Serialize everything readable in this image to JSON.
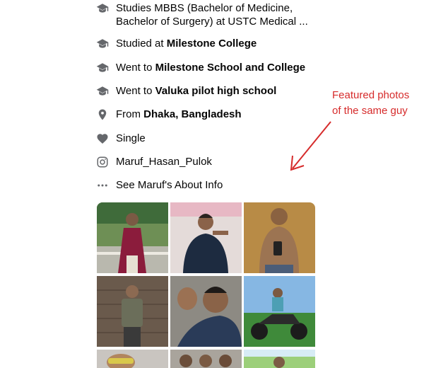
{
  "intro": {
    "studies": {
      "text": "Studies MBBS (Bachelor of Medicine, Bachelor of Surgery) at USTC Medical ...",
      "icon": "graduation-cap-icon"
    },
    "studied": {
      "prefix": "Studied at ",
      "place": "Milestone College",
      "icon": "graduation-cap-icon"
    },
    "went_to_1": {
      "prefix": "Went to ",
      "place": "Milestone School and College",
      "icon": "graduation-cap-icon"
    },
    "went_to_2": {
      "prefix": "Went to ",
      "place": "Valuka pilot high school",
      "icon": "graduation-cap-icon"
    },
    "from": {
      "prefix": "From ",
      "place": "Dhaka, Bangladesh",
      "icon": "location-pin-icon"
    },
    "relationship": {
      "text": "Single",
      "icon": "heart-icon"
    },
    "instagram": {
      "text": "Maruf_Hasan_Pulok",
      "icon": "instagram-icon"
    },
    "about": {
      "text": "See Maruf's About Info",
      "icon": "more-dots-icon"
    }
  },
  "annotation": {
    "line1": "Featured photos",
    "line2": "of the same guy",
    "color": "#d62b2b"
  },
  "colors": {
    "icon": "#65676b",
    "text": "#050505",
    "annotation": "#d62b2b"
  }
}
